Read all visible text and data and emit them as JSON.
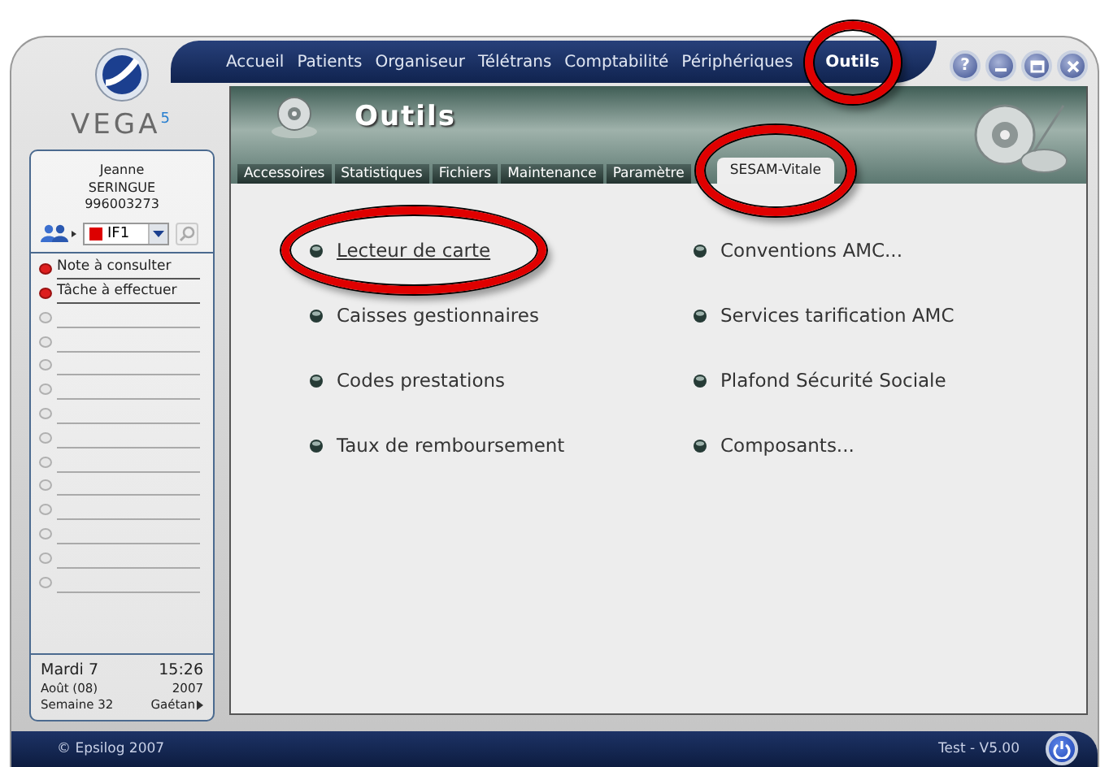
{
  "nav": {
    "items": [
      {
        "label": "Accueil",
        "selected": false,
        "circled": false
      },
      {
        "label": "Patients",
        "selected": false,
        "circled": false
      },
      {
        "label": "Organiseur",
        "selected": false,
        "circled": false
      },
      {
        "label": "Télétrans",
        "selected": false,
        "circled": false
      },
      {
        "label": "Comptabilité",
        "selected": false,
        "circled": false
      },
      {
        "label": "Périphériques",
        "selected": false,
        "circled": false
      },
      {
        "label": "Outils",
        "selected": true,
        "circled": true
      }
    ]
  },
  "window_buttons": [
    {
      "kind": "help",
      "label": "?"
    },
    {
      "kind": "minimize"
    },
    {
      "kind": "maximize"
    },
    {
      "kind": "close"
    }
  ],
  "sidebar": {
    "brand": "VEGA",
    "brand_sup": "5",
    "user": {
      "first_name": "Jeanne",
      "last_name": "SERINGUE",
      "number": "996003273"
    },
    "profile_select": {
      "value": "IF1",
      "color": "#dd0000"
    },
    "notes": [
      {
        "label": "Note à consulter",
        "flagged": true
      },
      {
        "label": "Tâche à effectuer",
        "flagged": true
      },
      {
        "flagged": false
      },
      {
        "flagged": false
      },
      {
        "flagged": false
      },
      {
        "flagged": false
      },
      {
        "flagged": false
      },
      {
        "flagged": false
      },
      {
        "flagged": false
      },
      {
        "flagged": false
      },
      {
        "flagged": false
      },
      {
        "flagged": false
      },
      {
        "flagged": false
      },
      {
        "flagged": false
      }
    ],
    "date": {
      "day": "Mardi 7",
      "time": "15:26",
      "month": "Août (08)",
      "year": "2007",
      "week": "Semaine 32",
      "user": "Gaétan"
    }
  },
  "page": {
    "title": "Outils",
    "tabs": [
      {
        "label": "Accessoires",
        "selected": false,
        "circled": false
      },
      {
        "label": "Statistiques",
        "selected": false,
        "circled": false
      },
      {
        "label": "Fichiers",
        "selected": false,
        "circled": false
      },
      {
        "label": "Maintenance",
        "selected": false,
        "circled": false
      },
      {
        "label": "Paramètre",
        "selected": false,
        "circled": false
      },
      {
        "label": "SESAM-Vitale",
        "selected": true,
        "circled": true
      }
    ],
    "menu_columns": [
      [
        {
          "label": "Lecteur de carte",
          "selected": true,
          "circled": true
        },
        {
          "label": "Caisses gestionnaires",
          "selected": false,
          "circled": false
        },
        {
          "label": "Codes prestations",
          "selected": false,
          "circled": false
        },
        {
          "label": "Taux de remboursement",
          "selected": false,
          "circled": false
        }
      ],
      [
        {
          "label": "Conventions AMC...",
          "selected": false,
          "circled": false
        },
        {
          "label": "Services tarification AMC",
          "selected": false,
          "circled": false
        },
        {
          "label": "Plafond Sécurité Sociale",
          "selected": false,
          "circled": false
        },
        {
          "label": "Composants...",
          "selected": false,
          "circled": false
        }
      ]
    ]
  },
  "footer": {
    "copyright": "© Epsilog 2007",
    "version": "Test - V5.00"
  }
}
